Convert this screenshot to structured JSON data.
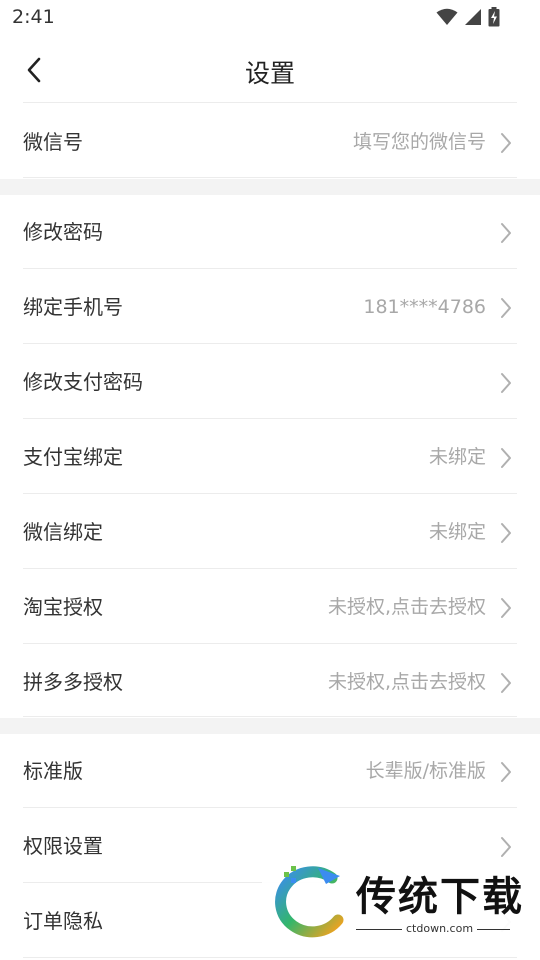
{
  "status_bar": {
    "time": "2:41",
    "icons": [
      "wifi-icon",
      "cellular-signal-icon",
      "battery-charging-icon"
    ]
  },
  "nav": {
    "title": "设置",
    "back_icon": "chevron-left-icon"
  },
  "sections": [
    {
      "rows": [
        {
          "label": "微信号",
          "value": "填写您的微信号"
        }
      ]
    },
    {
      "rows": [
        {
          "label": "修改密码",
          "value": ""
        },
        {
          "label": "绑定手机号",
          "value": "181****4786"
        },
        {
          "label": "修改支付密码",
          "value": ""
        },
        {
          "label": "支付宝绑定",
          "value": "未绑定"
        },
        {
          "label": "微信绑定",
          "value": "未绑定"
        },
        {
          "label": "淘宝授权",
          "value": "未授权,点击去授权"
        },
        {
          "label": "拼多多授权",
          "value": "未授权,点击去授权"
        }
      ]
    },
    {
      "rows": [
        {
          "label": "标准版",
          "value": "长辈版/标准版"
        },
        {
          "label": "权限设置",
          "value": ""
        },
        {
          "label": "订单隐私",
          "value": ""
        }
      ]
    }
  ],
  "watermark": {
    "brand": "传统下载",
    "domain": "ctdown.com"
  },
  "colors": {
    "label": "#333333",
    "value": "#a8a8a8",
    "divider": "#ececec",
    "section_gap": "#f3f3f3"
  }
}
